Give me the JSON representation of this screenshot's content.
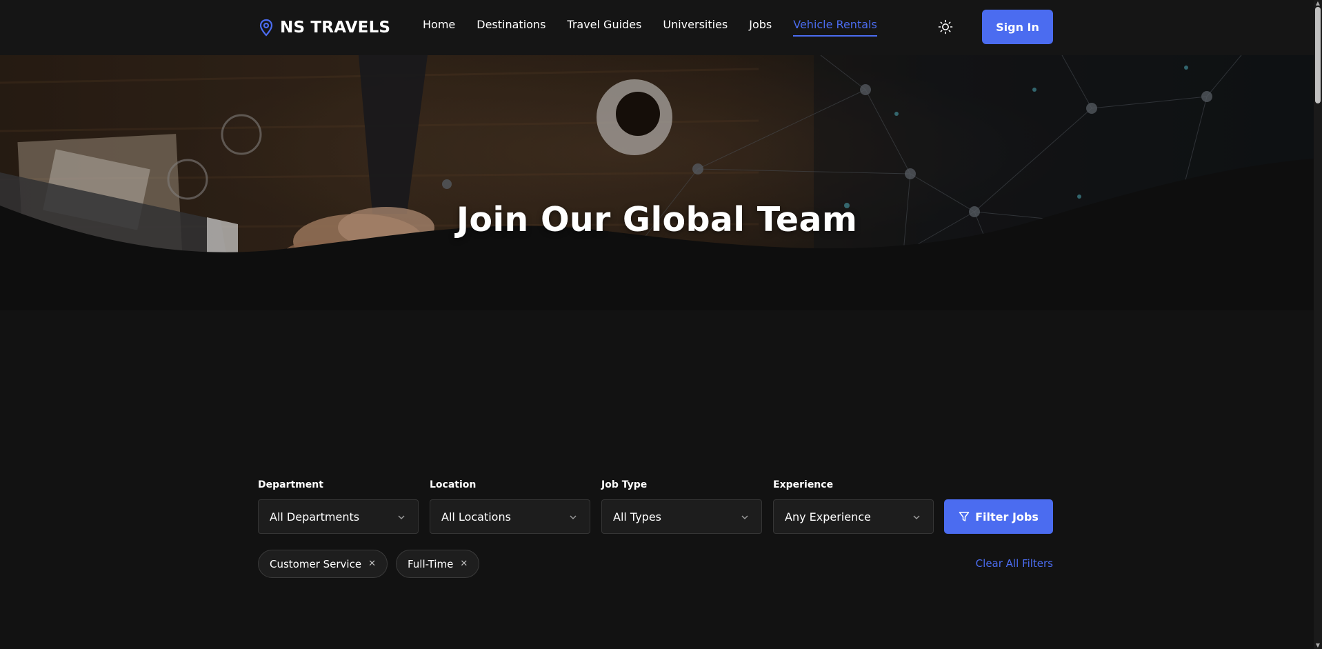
{
  "brand": {
    "name": "NS TRAVELS",
    "icon": "map-pin-icon"
  },
  "nav": {
    "items": [
      {
        "label": "Home",
        "active": false
      },
      {
        "label": "Destinations",
        "active": false
      },
      {
        "label": "Travel Guides",
        "active": false
      },
      {
        "label": "Universities",
        "active": false
      },
      {
        "label": "Jobs",
        "active": false
      },
      {
        "label": "Vehicle Rentals",
        "active": true
      }
    ],
    "theme_toggle_icon": "sun-icon",
    "signin_label": "Sign In"
  },
  "hero": {
    "title": "Join Our Global Team"
  },
  "filters": {
    "department": {
      "label": "Department",
      "value": "All Departments"
    },
    "location": {
      "label": "Location",
      "value": "All Locations"
    },
    "job_type": {
      "label": "Job Type",
      "value": "All Types"
    },
    "experience": {
      "label": "Experience",
      "value": "Any Experience"
    },
    "submit_label": "Filter Jobs",
    "submit_icon": "funnel-icon"
  },
  "active_filters": [
    {
      "label": "Customer Service"
    },
    {
      "label": "Full-Time"
    }
  ],
  "clear_all_label": "Clear All Filters",
  "colors": {
    "accent": "#4b6cf0",
    "background": "#121212",
    "header": "#151515"
  }
}
